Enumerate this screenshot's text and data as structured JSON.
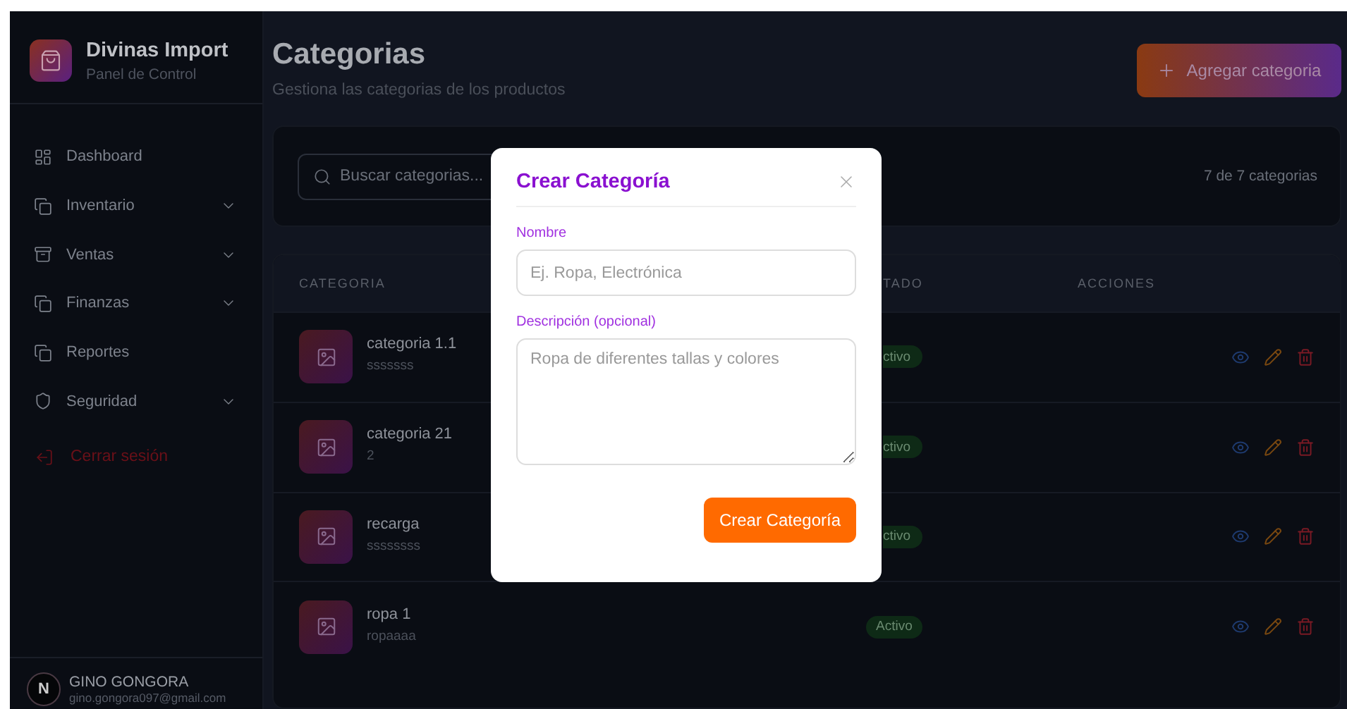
{
  "sidebar": {
    "brand": {
      "title": "Divinas Import",
      "subtitle": "Panel de Control"
    },
    "items": [
      {
        "label": "Dashboard",
        "kind": "dashboard",
        "expandable": false
      },
      {
        "label": "Inventario",
        "kind": "copy",
        "expandable": true
      },
      {
        "label": "Ventas",
        "kind": "archive",
        "expandable": true
      },
      {
        "label": "Finanzas",
        "kind": "copy",
        "expandable": true
      },
      {
        "label": "Reportes",
        "kind": "copy",
        "expandable": false
      },
      {
        "label": "Seguridad",
        "kind": "shield",
        "expandable": true
      }
    ],
    "logout": {
      "label": "Cerrar sesión"
    },
    "user": {
      "initial": "N",
      "name": "GINO GONGORA",
      "email": "gino.gongora097@gmail.com"
    }
  },
  "header": {
    "title": "Categorias",
    "subtitle": "Gestiona las categorias de los productos",
    "add_button": "Agregar categoria"
  },
  "search": {
    "placeholder": "Buscar categorias...",
    "count": "7 de 7 categorias"
  },
  "table": {
    "columns": [
      {
        "label": "CATEGORIA",
        "covered": false
      },
      {
        "label": "TADO",
        "covered": true
      },
      {
        "label": "ACCIONES",
        "covered": false
      }
    ],
    "rows": [
      {
        "name": "categoria 1.1",
        "description": "sssssss",
        "status": "ctivo",
        "covered": true
      },
      {
        "name": "categoria 21",
        "description": "2",
        "status": "ctivo",
        "covered": true
      },
      {
        "name": "recarga",
        "description": "ssssssss",
        "status": "ctivo",
        "covered": true
      },
      {
        "name": "ropa 1",
        "description": "ropaaaa",
        "status": "Activo",
        "covered": false
      }
    ]
  },
  "modal": {
    "title": "Crear Categoría",
    "fields": [
      {
        "kind": "input",
        "label": "Nombre",
        "placeholder": "Ej. Ropa, Electrónica"
      },
      {
        "kind": "textarea",
        "label": "Descripción (opcional)",
        "placeholder": "Ropa de diferentes tallas y colores"
      }
    ],
    "submit": "Crear Categoría"
  }
}
